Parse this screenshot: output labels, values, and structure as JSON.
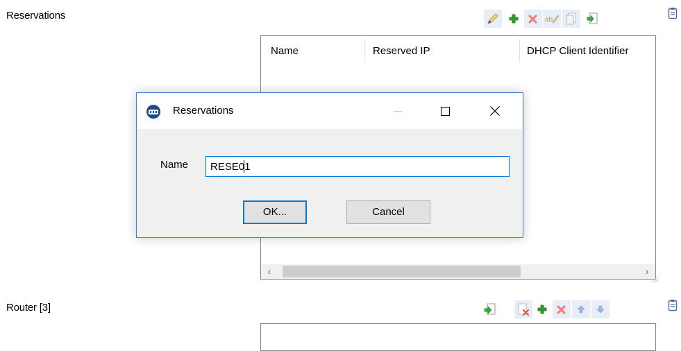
{
  "sections": {
    "reservations": {
      "title": "Reservations"
    },
    "router": {
      "title": "Router [3]"
    }
  },
  "reservations_list": {
    "columns": [
      "Name",
      "Reserved IP",
      "DHCP Client Identifier"
    ]
  },
  "toolbars": {
    "reservations": [
      "edit-icon",
      "add-icon",
      "delete-icon",
      "rename-icon",
      "copy-icon",
      "import-icon",
      "notes-icon"
    ],
    "router": [
      "import-icon",
      "remove-icon",
      "add-icon",
      "delete-icon",
      "move-up-icon",
      "move-down-icon",
      "notes-icon"
    ]
  },
  "dialog": {
    "title": "Reservations",
    "name_label": "Name",
    "name_value": "RESE01",
    "ok_label": "OK...",
    "cancel_label": "Cancel"
  },
  "colors": {
    "accent": "#0078d7",
    "add_green": "#1f9a1f",
    "delete_red": "#e81123",
    "arrow_blue": "#6f8fd6"
  }
}
